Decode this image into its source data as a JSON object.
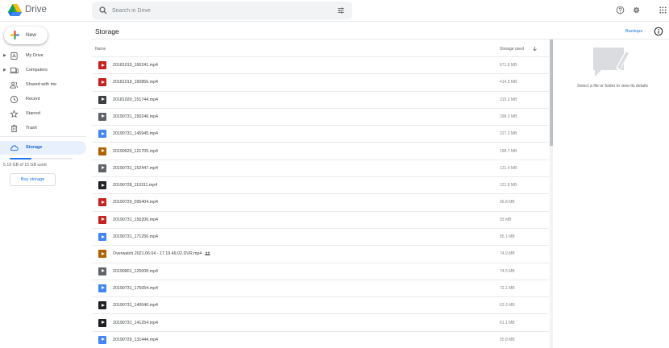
{
  "header": {
    "app_title": "Drive",
    "search_placeholder": "Search in Drive"
  },
  "sidebar": {
    "new_label": "New",
    "items": [
      {
        "label": "My Drive",
        "icon": "my-drive-icon"
      },
      {
        "label": "Computers",
        "icon": "computers-icon"
      },
      {
        "label": "Shared with me",
        "icon": "shared-with-me-icon"
      },
      {
        "label": "Recent",
        "icon": "clock-icon"
      },
      {
        "label": "Starred",
        "icon": "star-icon"
      },
      {
        "label": "Trash",
        "icon": "trash-icon"
      },
      {
        "label": "Storage",
        "icon": "cloud-icon"
      }
    ],
    "storage_used_text": "5.19 GB of 15 GB used",
    "storage_fraction": 0.346,
    "buy_storage_label": "Buy storage"
  },
  "main": {
    "title": "Storage",
    "backups_label": "Backups",
    "columns": {
      "name": "Name",
      "size": "Storage used"
    },
    "files": [
      {
        "name": "20181019_160241.mp4",
        "size": "671.8 MB",
        "color": "#c5221f"
      },
      {
        "name": "20181019_160856.mp4",
        "size": "414.5 MB",
        "color": "#c5221f"
      },
      {
        "name": "20181020_151744.mp4",
        "size": "315.3 MB",
        "color": "#3c4043"
      },
      {
        "name": "20190731_150246.mp4",
        "size": "298.3 MB",
        "color": "#5f6368"
      },
      {
        "name": "20190731_145945.mp4",
        "size": "227.3 MB",
        "color": "#4285f4"
      },
      {
        "name": "20190629_121705.mp4",
        "size": "198.7 MB",
        "color": "#b06000"
      },
      {
        "name": "20190731_152447.mp4",
        "size": "131.4 MB",
        "color": "#5f6368"
      },
      {
        "name": "20190728_110311.mp4",
        "size": "121.8 MB",
        "color": "#202124"
      },
      {
        "name": "20190729_095404.mp4",
        "size": "96.8 MB",
        "color": "#c5221f"
      },
      {
        "name": "20190731_150206.mp4",
        "size": "93 MB",
        "color": "#c5221f"
      },
      {
        "name": "20190731_171256.mp4",
        "size": "85.1 MB",
        "color": "#4285f4"
      },
      {
        "name": "Overwatch 2021.06.04 - 17.19.49.02.DVR.mp4",
        "size": "74.9 MB",
        "color": "#b06000",
        "shared": true
      },
      {
        "name": "20190801_125008.mp4",
        "size": "74.5 MB",
        "color": "#5f6368"
      },
      {
        "name": "20190731_175054.mp4",
        "size": "72.1 MB",
        "color": "#4285f4"
      },
      {
        "name": "20190731_140040.mp4",
        "size": "63.2 MB",
        "color": "#202124"
      },
      {
        "name": "20190731_141254.mp4",
        "size": "61.1 MB",
        "color": "#202124"
      },
      {
        "name": "20190729_131444.mp4",
        "size": "55.8 MB",
        "color": "#4285f4"
      }
    ]
  },
  "details": {
    "hint": "Select a file or folder to view its details"
  },
  "colors": {
    "accent": "#1a73e8",
    "active_bg": "#e8f0fe"
  }
}
